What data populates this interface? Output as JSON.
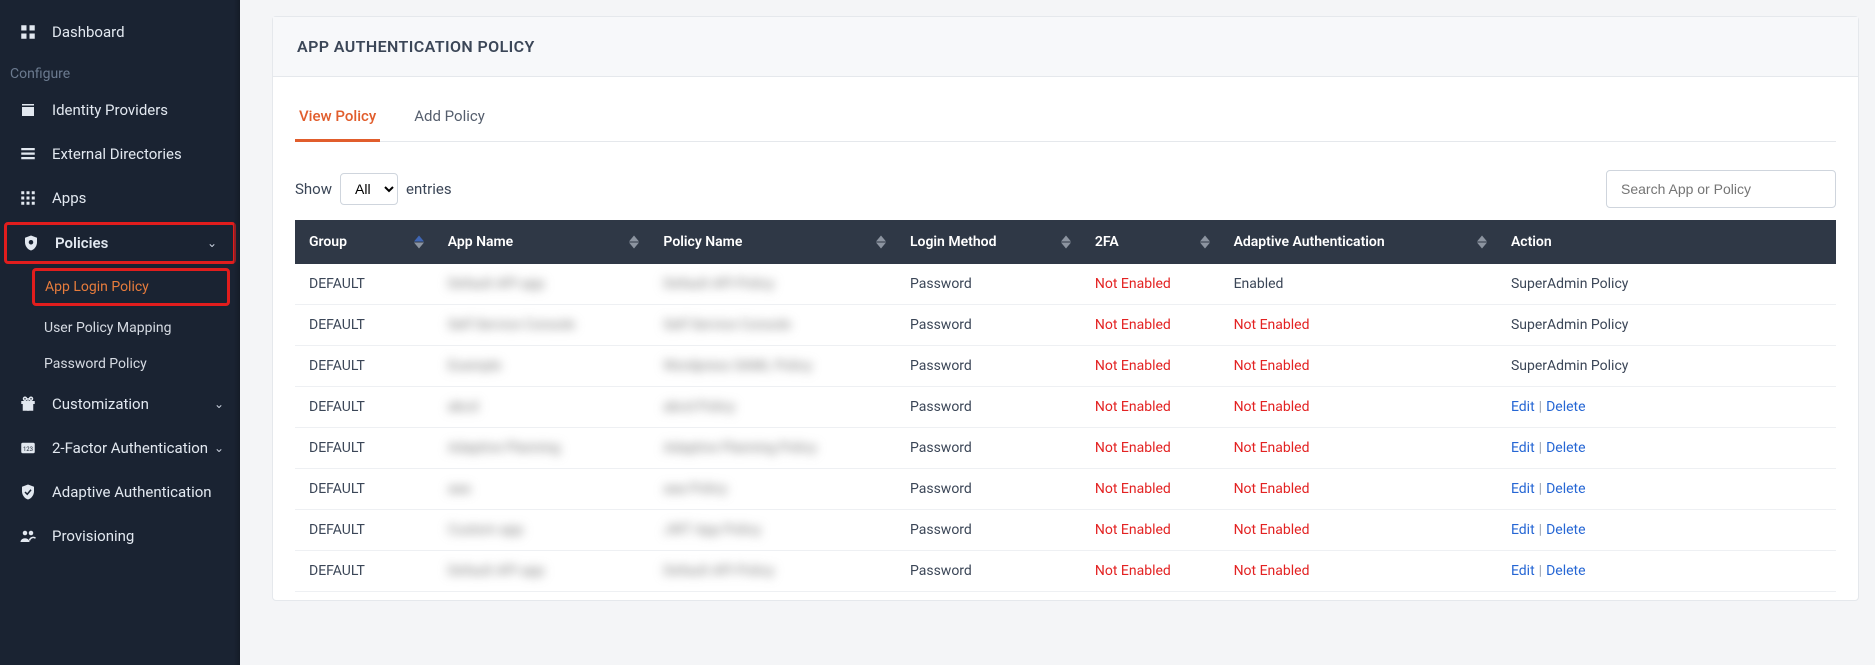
{
  "sidebar": {
    "section_label": "Configure",
    "items": [
      {
        "label": "Dashboard"
      },
      {
        "label": "Identity Providers"
      },
      {
        "label": "External Directories"
      },
      {
        "label": "Apps"
      },
      {
        "label": "Policies"
      },
      {
        "label": "Customization"
      },
      {
        "label": "2-Factor Authentication"
      },
      {
        "label": "Adaptive Authentication"
      },
      {
        "label": "Provisioning"
      }
    ],
    "policies_sub": [
      {
        "label": "App Login Policy"
      },
      {
        "label": "User Policy Mapping"
      },
      {
        "label": "Password Policy"
      }
    ]
  },
  "page": {
    "title": "APP AUTHENTICATION POLICY",
    "tabs": {
      "view": "View Policy",
      "add": "Add Policy"
    },
    "show_label_pre": "Show",
    "show_label_post": "entries",
    "show_selected": "All",
    "search_placeholder": "Search App or Policy"
  },
  "table": {
    "columns": {
      "group": "Group",
      "app_name": "App Name",
      "policy_name": "Policy Name",
      "login_method": "Login Method",
      "twofa": "2FA",
      "adaptive": "Adaptive Authentication",
      "action": "Action"
    },
    "status": {
      "not_enabled": "Not Enabled",
      "enabled": "Enabled"
    },
    "action_labels": {
      "super": "SuperAdmin Policy",
      "edit": "Edit",
      "delete": "Delete"
    },
    "rows": [
      {
        "group": "DEFAULT",
        "app": "Default API app",
        "policy": "Default API Policy",
        "login": "Password",
        "twofa": "not_enabled",
        "adaptive": "enabled",
        "action": "super"
      },
      {
        "group": "DEFAULT",
        "app": "Self Service Console",
        "policy": "Self Service Console",
        "login": "Password",
        "twofa": "not_enabled",
        "adaptive": "not_enabled",
        "action": "super"
      },
      {
        "group": "DEFAULT",
        "app": "Example",
        "policy": "Wordpress SAML Policy",
        "login": "Password",
        "twofa": "not_enabled",
        "adaptive": "not_enabled",
        "action": "super"
      },
      {
        "group": "DEFAULT",
        "app": "abcd",
        "policy": "abcd Policy",
        "login": "Password",
        "twofa": "not_enabled",
        "adaptive": "not_enabled",
        "action": "editdelete"
      },
      {
        "group": "DEFAULT",
        "app": "Adaptive Planning",
        "policy": "Adaptive Planning Policy",
        "login": "Password",
        "twofa": "not_enabled",
        "adaptive": "not_enabled",
        "action": "editdelete"
      },
      {
        "group": "DEFAULT",
        "app": "aaa",
        "policy": "aaa Policy",
        "login": "Password",
        "twofa": "not_enabled",
        "adaptive": "not_enabled",
        "action": "editdelete"
      },
      {
        "group": "DEFAULT",
        "app": "Custom app",
        "policy": "JWT App Policy",
        "login": "Password",
        "twofa": "not_enabled",
        "adaptive": "not_enabled",
        "action": "editdelete"
      },
      {
        "group": "DEFAULT",
        "app": "Default API app",
        "policy": "Default API Policy",
        "login": "Password",
        "twofa": "not_enabled",
        "adaptive": "not_enabled",
        "action": "editdelete"
      }
    ]
  }
}
